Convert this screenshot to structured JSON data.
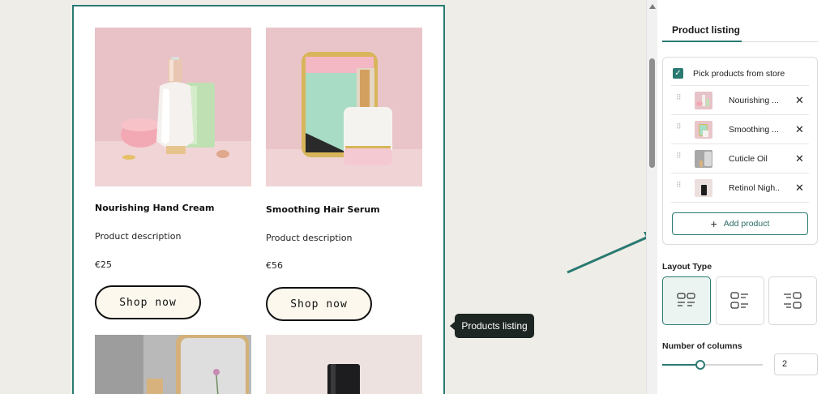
{
  "colors": {
    "accent": "#2a7a72",
    "canvas_bg": "#eeede8",
    "button_bg": "#fcf8ee",
    "tooltip_bg": "#1e2624"
  },
  "products": [
    {
      "name": "Nourishing Hand Cream",
      "description": "Product description",
      "price": "€25",
      "cta": "Shop now",
      "image": "cosmetic-bottles-pink-image"
    },
    {
      "name": "Smoothing Hair Serum",
      "description": "Product description",
      "price": "€56",
      "cta": "Shop now",
      "image": "serum-bottle-mirror-image"
    }
  ],
  "tooltip": {
    "label": "Products listing"
  },
  "panel": {
    "tab_label": "Product listing",
    "pick_label": "Pick products from store",
    "pick_checked": true,
    "items": [
      {
        "name": "Nourishing ..."
      },
      {
        "name": "Smoothing ..."
      },
      {
        "name": "Cuticle Oil"
      },
      {
        "name": "Retinol Nigh..."
      }
    ],
    "add_button": "Add product",
    "layout_label": "Layout Type",
    "layout_options": [
      "grid-layout-icon",
      "list-layout-icon",
      "list-reversed-layout-icon"
    ],
    "layout_selected": 0,
    "columns_label": "Number of columns",
    "columns_value": "2"
  }
}
